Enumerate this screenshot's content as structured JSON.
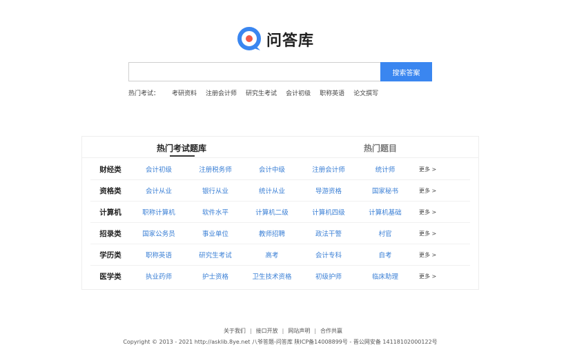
{
  "logo": {
    "text": "问答库",
    "mark_color": "#3a86f0",
    "dot_color": "#f05a4a"
  },
  "search": {
    "value": "",
    "placeholder": "",
    "button_label": "搜索答案"
  },
  "hot_searches": {
    "label": "热门考试：",
    "items": [
      "考研资料",
      "注册会计师",
      "研究生考试",
      "会计初级",
      "职称英语",
      "论文撰写"
    ]
  },
  "tabs": {
    "active": "热门考试题库",
    "inactive": "热门题目"
  },
  "categories": [
    {
      "name": "财经类",
      "items": [
        "会计初级",
        "注册税务师",
        "会计中级",
        "注册会计师",
        "统计师"
      ],
      "more": "更多 >"
    },
    {
      "name": "资格类",
      "items": [
        "会计从业",
        "银行从业",
        "统计从业",
        "导游资格",
        "国家秘书"
      ],
      "more": "更多 >"
    },
    {
      "name": "计算机",
      "items": [
        "职称计算机",
        "软件水平",
        "计算机二级",
        "计算机四级",
        "计算机基础"
      ],
      "more": "更多 >"
    },
    {
      "name": "招录类",
      "items": [
        "国家公务员",
        "事业单位",
        "教师招聘",
        "政法干警",
        "村官"
      ],
      "more": "更多 >"
    },
    {
      "name": "学历类",
      "items": [
        "职称英语",
        "研究生考试",
        "高考",
        "会计专科",
        "自考"
      ],
      "more": "更多 >"
    },
    {
      "name": "医学类",
      "items": [
        "执业药师",
        "护士资格",
        "卫生技术资格",
        "初级护师",
        "临床助理"
      ],
      "more": "更多 >"
    }
  ],
  "footer": {
    "links": [
      "关于我们",
      "接口开放",
      "网站声明",
      "合作共赢"
    ],
    "copyright": "Copyright © 2013 - 2021 http://asklib.8ye.net  八爷答题-问答库   陕ICP备14008899号 - 晋公网安备 14118102000122号"
  }
}
